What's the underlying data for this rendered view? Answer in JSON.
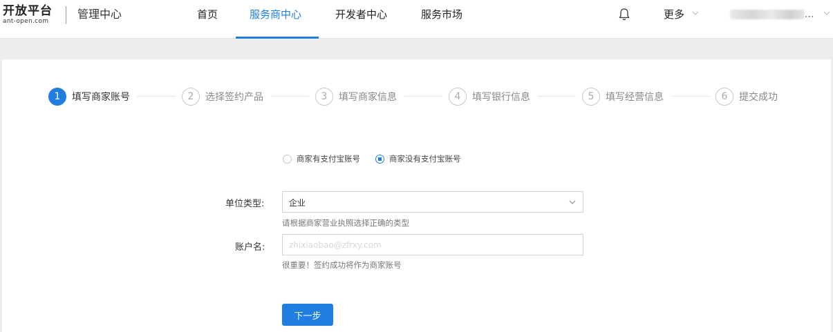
{
  "header": {
    "logo_text": "开放平台",
    "logo_sub": "ant-open.com",
    "console_title": "管理中心",
    "nav": [
      "首页",
      "服务商中心",
      "开发者中心",
      "服务市场"
    ],
    "active_nav": "服务商中心",
    "more_label": "更多",
    "user_suffix": "..."
  },
  "steps": [
    {
      "num": "1",
      "label": "填写商家账号",
      "active": true
    },
    {
      "num": "2",
      "label": "选择签约产品",
      "active": false
    },
    {
      "num": "3",
      "label": "填写商家信息",
      "active": false
    },
    {
      "num": "4",
      "label": "填写银行信息",
      "active": false
    },
    {
      "num": "5",
      "label": "填写经营信息",
      "active": false
    },
    {
      "num": "6",
      "label": "提交成功",
      "active": false
    }
  ],
  "account_type": {
    "options": [
      "商家有支付宝账号",
      "商家没有支付宝账号"
    ],
    "selected": "商家没有支付宝账号"
  },
  "form": {
    "unit_type_label": "单位类型:",
    "unit_type_value": "企业",
    "unit_type_hint": "请根据商家营业执照选择正确的类型",
    "account_label": "账户名:",
    "account_placeholder": "zhixiaobao@zfrxy.com",
    "account_hint": "很重要！签约成功将作为商家账号"
  },
  "next_button": "下一步",
  "colors": {
    "accent": "#1f7ee0"
  }
}
